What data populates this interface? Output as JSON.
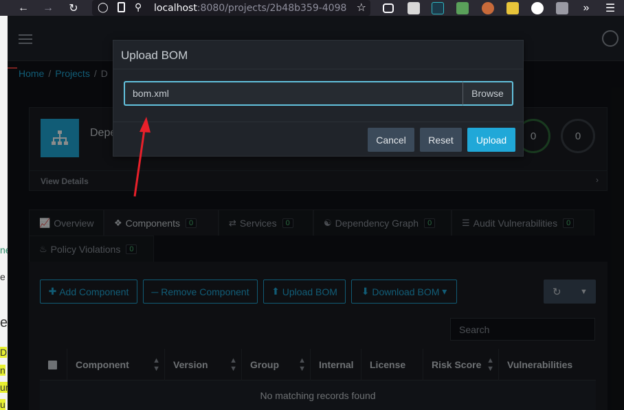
{
  "browser": {
    "url_host": "localhost",
    "url_rest": ":8080/projects/2b48b359-4098"
  },
  "breadcrumb": {
    "home": "Home",
    "projects": "Projects",
    "separator": "/",
    "current_fragment": "D"
  },
  "project": {
    "name_fragment": "Depe",
    "view_details": "View Details",
    "stat_a": "0",
    "stat_b": "0"
  },
  "tabs": [
    {
      "label": "Overview",
      "badge": ""
    },
    {
      "label": "Components",
      "badge": "0"
    },
    {
      "label": "Services",
      "badge": "0"
    },
    {
      "label": "Dependency Graph",
      "badge": "0"
    },
    {
      "label": "Audit Vulnerabilities",
      "badge": "0"
    },
    {
      "label": "Policy Violations",
      "badge": "0"
    }
  ],
  "toolbar": {
    "add_component": "Add Component",
    "remove_component": "Remove Component",
    "upload_bom": "Upload BOM",
    "download_bom": "Download BOM"
  },
  "search": {
    "placeholder": "Search"
  },
  "table": {
    "headers": [
      "Component",
      "Version",
      "Group",
      "Internal",
      "License",
      "Risk Score",
      "Vulnerabilities"
    ],
    "empty_message": "No matching records found"
  },
  "modal": {
    "title": "Upload BOM",
    "file_value": "bom.xml",
    "browse_label": "Browse",
    "cancel_label": "Cancel",
    "reset_label": "Reset",
    "upload_label": "Upload"
  },
  "colors": {
    "accent": "#20a8d8",
    "annotation_arrow": "#e8202a",
    "badge_green": "#4dbd74"
  },
  "left_strip_fragments": [
    "ne",
    "e",
    "e",
    "D",
    "n",
    "un",
    "u"
  ]
}
